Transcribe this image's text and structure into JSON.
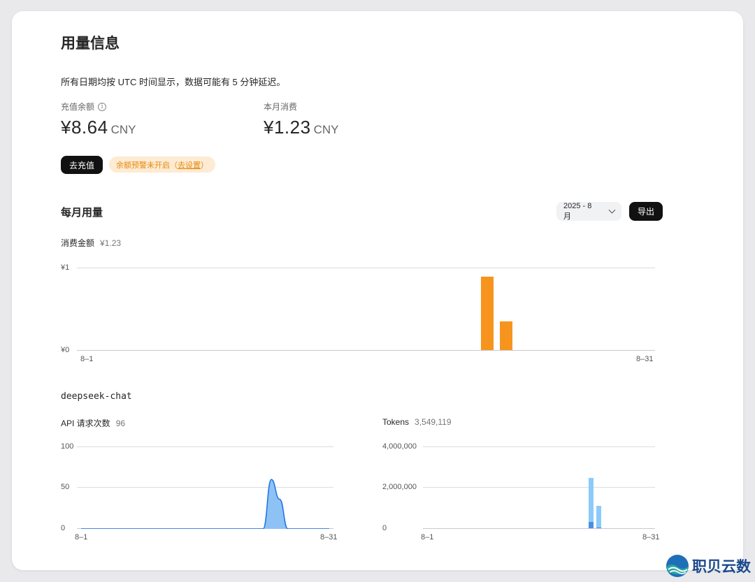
{
  "page": {
    "title": "用量信息",
    "note": "所有日期均按 UTC 时间显示，数据可能有 5 分钟延迟。"
  },
  "balance": {
    "label": "充值余额",
    "info_icon": "info-icon",
    "value": "¥8.64",
    "unit": "CNY"
  },
  "monthly_spend": {
    "label": "本月消费",
    "value": "¥1.23",
    "unit": "CNY"
  },
  "actions": {
    "recharge_label": "去充值",
    "warning_text": "余额预警未开启（",
    "warning_link": "去设置",
    "warning_close": "）"
  },
  "monthly_usage": {
    "title": "每月用量",
    "month_select": "2025 - 8月",
    "export_label": "导出"
  },
  "cost_chart": {
    "label": "消费金额",
    "total": "¥1.23"
  },
  "model": {
    "name": "deepseek-chat",
    "requests_label": "API 请求次数",
    "requests_total": "96",
    "tokens_label": "Tokens",
    "tokens_total": "3,549,119"
  },
  "colors": {
    "cost_bar": "#f7941d",
    "requests_line": "#1a73e8",
    "requests_fill": "#8ec2f5",
    "tokens_light": "#8ccbf9",
    "tokens_dark": "#4a90e2"
  },
  "logo": {
    "text": "职贝云数"
  },
  "chart_data": [
    {
      "type": "bar",
      "name": "cost",
      "x": [
        "8-1",
        "8-2",
        "8-3",
        "8-4",
        "8-5",
        "8-6",
        "8-7",
        "8-8",
        "8-9",
        "8-10",
        "8-11",
        "8-12",
        "8-13",
        "8-14",
        "8-15",
        "8-16",
        "8-17",
        "8-18",
        "8-19",
        "8-20",
        "8-21",
        "8-22",
        "8-23",
        "8-24",
        "8-25",
        "8-26",
        "8-27",
        "8-28",
        "8-29",
        "8-30",
        "8-31"
      ],
      "values": [
        0,
        0,
        0,
        0,
        0,
        0,
        0,
        0,
        0,
        0,
        0,
        0,
        0,
        0,
        0,
        0,
        0,
        0,
        0,
        0,
        0,
        0,
        0.89,
        0.35,
        0,
        0,
        0,
        0,
        0,
        0,
        0
      ],
      "yticks": [
        "¥1",
        "¥0"
      ],
      "ylim": [
        0,
        1
      ],
      "xtick_labels": [
        "8–1",
        "8–31"
      ]
    },
    {
      "type": "area",
      "name": "api_requests",
      "x": [
        "8-1",
        "8-2",
        "8-3",
        "8-4",
        "8-5",
        "8-6",
        "8-7",
        "8-8",
        "8-9",
        "8-10",
        "8-11",
        "8-12",
        "8-13",
        "8-14",
        "8-15",
        "8-16",
        "8-17",
        "8-18",
        "8-19",
        "8-20",
        "8-21",
        "8-22",
        "8-23",
        "8-24",
        "8-25",
        "8-26",
        "8-27",
        "8-28",
        "8-29",
        "8-30",
        "8-31"
      ],
      "values": [
        0,
        0,
        0,
        0,
        0,
        0,
        0,
        0,
        0,
        0,
        0,
        0,
        0,
        0,
        0,
        0,
        0,
        0,
        0,
        0,
        0,
        0,
        0,
        60,
        36,
        0,
        0,
        0,
        0,
        0,
        0
      ],
      "yticks": [
        "100",
        "50",
        "0"
      ],
      "ylim": [
        0,
        100
      ],
      "xtick_labels": [
        "8–1",
        "8–31"
      ]
    },
    {
      "type": "bar",
      "name": "tokens",
      "x": [
        "8-1",
        "8-2",
        "8-3",
        "8-4",
        "8-5",
        "8-6",
        "8-7",
        "8-8",
        "8-9",
        "8-10",
        "8-11",
        "8-12",
        "8-13",
        "8-14",
        "8-15",
        "8-16",
        "8-17",
        "8-18",
        "8-19",
        "8-20",
        "8-21",
        "8-22",
        "8-23",
        "8-24",
        "8-25",
        "8-26",
        "8-27",
        "8-28",
        "8-29",
        "8-30",
        "8-31"
      ],
      "series": [
        {
          "values": [
            0,
            0,
            0,
            0,
            0,
            0,
            0,
            0,
            0,
            0,
            0,
            0,
            0,
            0,
            0,
            0,
            0,
            0,
            0,
            0,
            0,
            0,
            300000,
            50000,
            0,
            0,
            0,
            0,
            0,
            0,
            0
          ]
        },
        {
          "values": [
            0,
            0,
            0,
            0,
            0,
            0,
            0,
            0,
            0,
            0,
            0,
            0,
            0,
            0,
            0,
            0,
            0,
            0,
            0,
            0,
            0,
            0,
            2150000,
            1050000,
            0,
            0,
            0,
            0,
            0,
            0,
            0
          ]
        }
      ],
      "stacked": true,
      "yticks": [
        "4,000,000",
        "2,000,000",
        "0"
      ],
      "ylim": [
        0,
        4000000
      ],
      "xtick_labels": [
        "8–1",
        "8–31"
      ]
    }
  ]
}
